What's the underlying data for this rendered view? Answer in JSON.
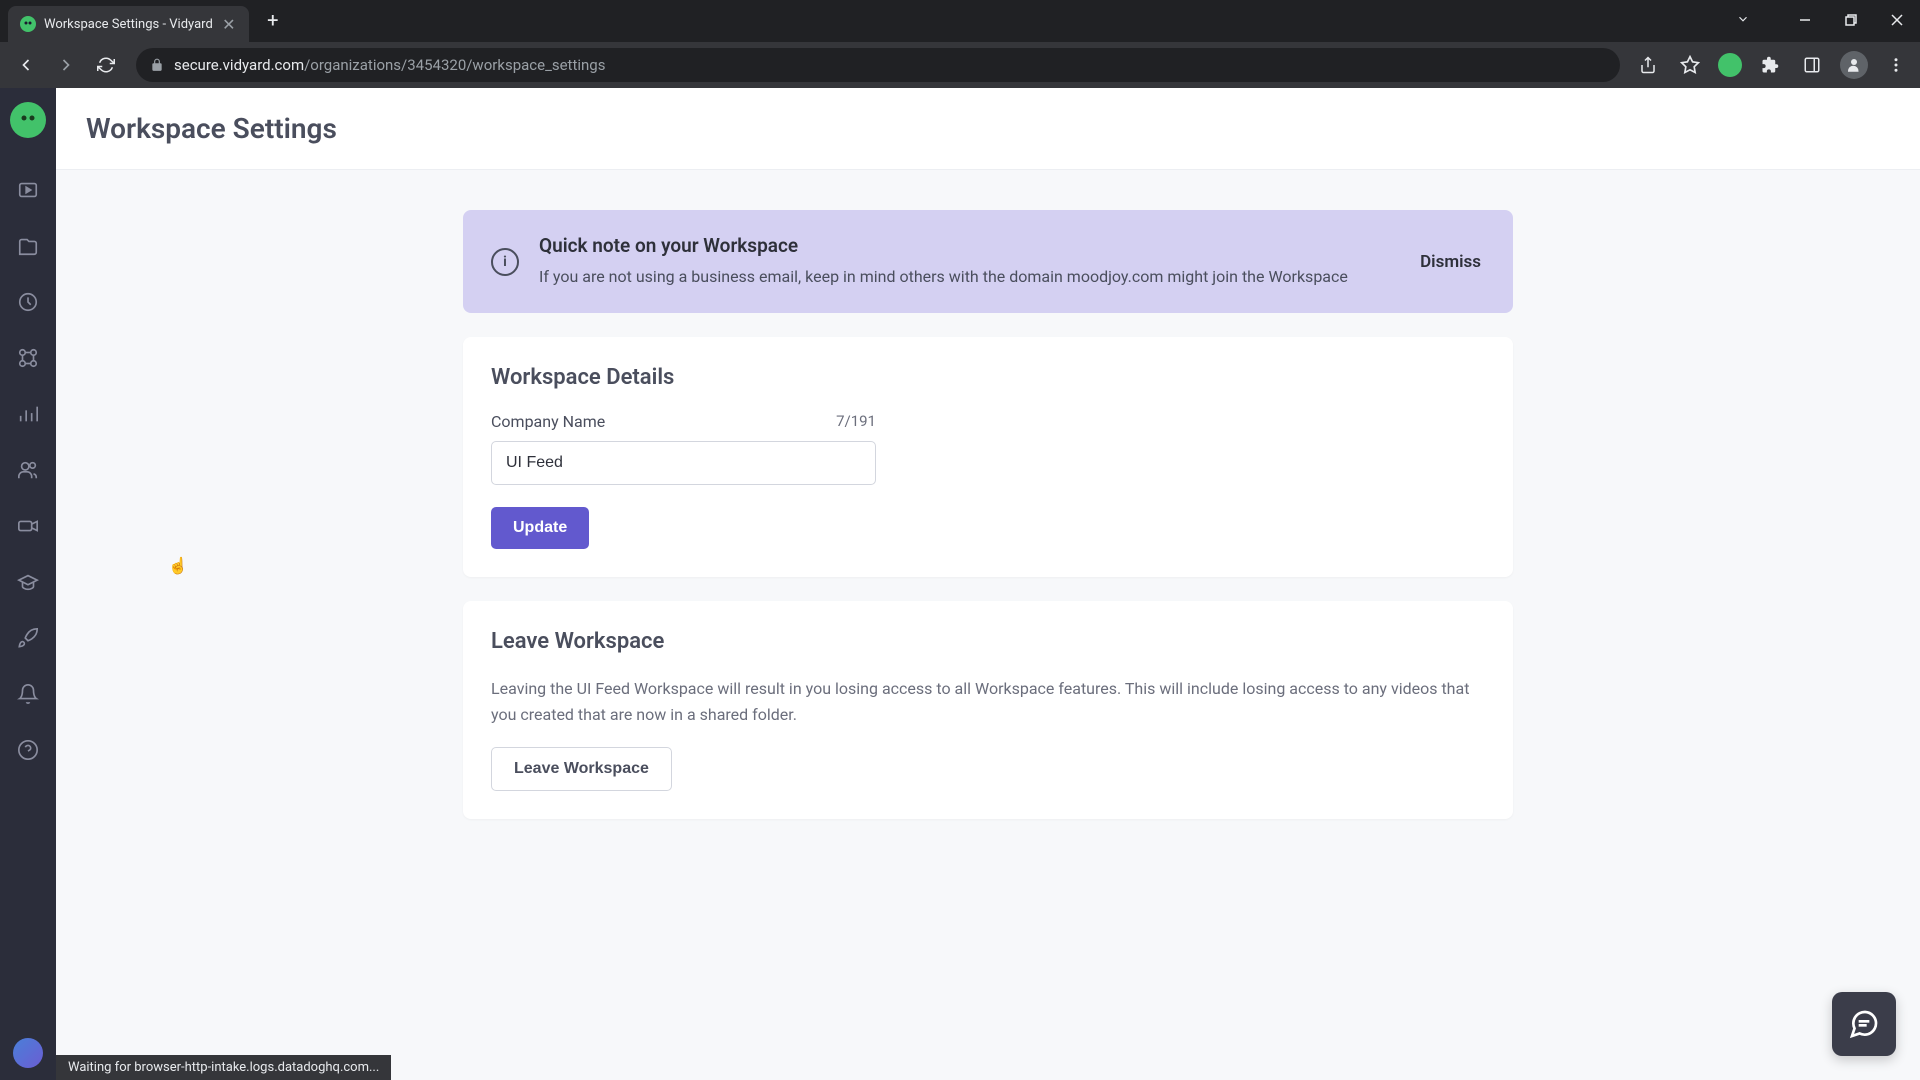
{
  "browser": {
    "tab_title": "Workspace Settings - Vidyard",
    "url_domain": "secure.vidyard.com",
    "url_path": "/organizations/3454320/workspace_settings",
    "status_text": "Waiting for browser-http-intake.logs.datadoghq.com..."
  },
  "page": {
    "title": "Workspace Settings"
  },
  "alert": {
    "title": "Quick note on your Workspace",
    "text": "If you are not using a business email, keep in mind others with the domain moodjoy.com might join the Workspace",
    "dismiss_label": "Dismiss"
  },
  "details_card": {
    "title": "Workspace Details",
    "company_label": "Company Name",
    "char_count": "7/191",
    "company_value": "UI Feed",
    "update_label": "Update"
  },
  "leave_card": {
    "title": "Leave Workspace",
    "text": "Leaving the UI Feed Workspace will result in you losing access to all Workspace features. This will include losing access to any videos that you created that are now in a shared folder.",
    "button_label": "Leave Workspace"
  }
}
